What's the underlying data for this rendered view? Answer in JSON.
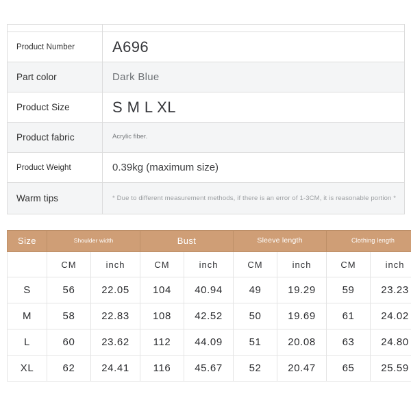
{
  "spec_table": {
    "rows": [
      {
        "label": "Product Number",
        "value": "A696",
        "value_style": "big"
      },
      {
        "label": "Part color",
        "value": "Dark Blue",
        "value_style": "mid"
      },
      {
        "label": "Product Size",
        "value": "S M L XL",
        "value_style": "big"
      },
      {
        "label": "Product fabric",
        "value": "Acrylic fiber.",
        "value_style": "tiny"
      },
      {
        "label": "Product Weight",
        "value": "0.39kg (maximum size)",
        "value_style": "med"
      },
      {
        "label": "Warm tips",
        "value": "* Due to different measurement methods, if there is an error of 1-3CM, it is reasonable portion *",
        "value_style": "note"
      }
    ]
  },
  "size_chart": {
    "type": "table",
    "group_headers": [
      {
        "label": "Size",
        "colspan": 1
      },
      {
        "label": "Shoulder width",
        "colspan": 2
      },
      {
        "label": "Bust",
        "colspan": 2
      },
      {
        "label": "Sleeve length",
        "colspan": 2
      },
      {
        "label": "Clothing length",
        "colspan": 2
      }
    ],
    "unit_headers": [
      "",
      "CM",
      "inch",
      "CM",
      "inch",
      "CM",
      "inch",
      "CM",
      "inch"
    ],
    "rows": [
      {
        "size": "S",
        "shoulder_cm": "56",
        "shoulder_in": "22.05",
        "bust_cm": "104",
        "bust_in": "40.94",
        "sleeve_cm": "49",
        "sleeve_in": "19.29",
        "length_cm": "59",
        "length_in": "23.23"
      },
      {
        "size": "M",
        "shoulder_cm": "58",
        "shoulder_in": "22.83",
        "bust_cm": "108",
        "bust_in": "42.52",
        "sleeve_cm": "50",
        "sleeve_in": "19.69",
        "length_cm": "61",
        "length_in": "24.02"
      },
      {
        "size": "L",
        "shoulder_cm": "60",
        "shoulder_in": "23.62",
        "bust_cm": "112",
        "bust_in": "44.09",
        "sleeve_cm": "51",
        "sleeve_in": "20.08",
        "length_cm": "63",
        "length_in": "24.80"
      },
      {
        "size": "XL",
        "shoulder_cm": "62",
        "shoulder_in": "24.41",
        "bust_cm": "116",
        "bust_in": "45.67",
        "sleeve_cm": "52",
        "sleeve_in": "20.47",
        "length_cm": "65",
        "length_in": "25.59"
      }
    ]
  },
  "colors": {
    "header_tan": "#cf9e76",
    "row_shade": "#f4f5f6",
    "border": "#dcdcdc",
    "text_dark": "#2e2e2e",
    "text_muted": "#9b9ea1"
  }
}
